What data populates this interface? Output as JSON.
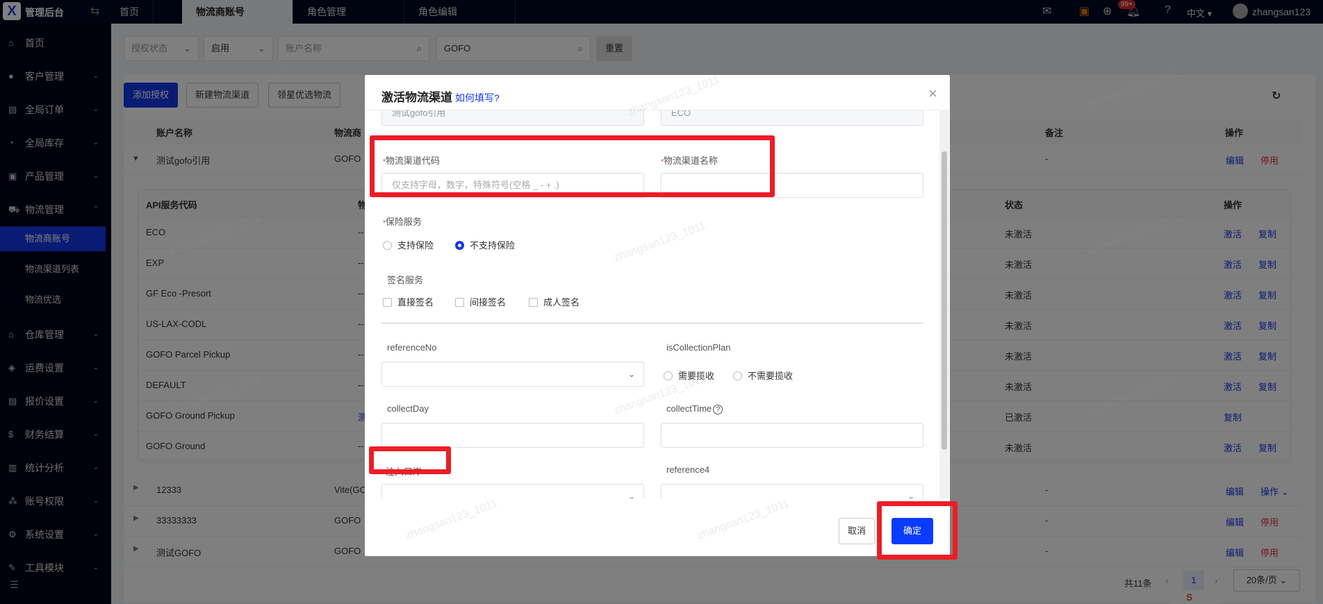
{
  "app": {
    "title": "管理后台",
    "logo": "X"
  },
  "tabs": [
    {
      "label": "首页"
    },
    {
      "label": "物流商账号",
      "active": true
    },
    {
      "label": "角色管理"
    },
    {
      "label": "角色编辑"
    }
  ],
  "header": {
    "notif_badge": "99+",
    "lang": "中文",
    "username": "zhangsan123"
  },
  "sidebar": {
    "items": [
      {
        "label": "首页",
        "icon": "home-icon",
        "glyph": "⌂"
      },
      {
        "label": "客户管理",
        "icon": "user-icon",
        "glyph": "●",
        "arrow": "⌄"
      },
      {
        "label": "全局订单",
        "icon": "order-icon",
        "glyph": "▤",
        "arrow": "⌄"
      },
      {
        "label": "全局库存",
        "icon": "inventory-icon",
        "glyph": "◔",
        "arrow": "⌄"
      },
      {
        "label": "产品管理",
        "icon": "product-icon",
        "glyph": "▣",
        "arrow": "⌄"
      },
      {
        "label": "物流管理",
        "icon": "truck-icon",
        "glyph": "⛟",
        "arrow": "⌃"
      }
    ],
    "sub_items": [
      {
        "label": "物流商账号",
        "active": true
      },
      {
        "label": "物流渠道列表"
      },
      {
        "label": "物流优选"
      }
    ],
    "items2": [
      {
        "label": "仓库管理",
        "icon": "warehouse-icon",
        "glyph": "⌂",
        "arrow": "⌄"
      },
      {
        "label": "运费设置",
        "icon": "freight-icon",
        "glyph": "◈",
        "arrow": "⌄"
      },
      {
        "label": "报价设置",
        "icon": "quote-icon",
        "glyph": "▤",
        "arrow": "⌄"
      },
      {
        "label": "财务结算",
        "icon": "finance-icon",
        "glyph": "$",
        "arrow": "⌄"
      },
      {
        "label": "统计分析",
        "icon": "stats-icon",
        "glyph": "▥",
        "arrow": "⌄"
      },
      {
        "label": "账号权限",
        "icon": "permission-icon",
        "glyph": "⁂",
        "arrow": "⌄"
      },
      {
        "label": "系统设置",
        "icon": "settings-icon",
        "glyph": "⚙",
        "arrow": "⌄"
      },
      {
        "label": "工具模块",
        "icon": "tool-icon",
        "glyph": "✎",
        "arrow": "⌄"
      }
    ],
    "collapse": "☰"
  },
  "filters": {
    "auth_status_placeholder": "授权状态",
    "status_value": "启用",
    "account_placeholder": "账户名称",
    "search_value": "GOFO",
    "reset": "重置"
  },
  "actions": {
    "add_auth": "添加授权",
    "new_channel": "新建物流渠道",
    "lingxing": "领星优选物流"
  },
  "table": {
    "headers": {
      "account": "账户名称",
      "carrier": "物流商",
      "remark": "备注",
      "ops": "操作"
    },
    "expanded_row": {
      "account": "测试gofo引用",
      "carrier": "GOFO",
      "remark": "-",
      "edit": "编辑",
      "disable": "停用"
    },
    "sub_headers": {
      "code": "API服务代码",
      "col2": "物",
      "status": "状态",
      "ops": "操作"
    },
    "sub_rows": [
      {
        "code": "ECO",
        "col2": "--",
        "status": "未激活",
        "activate": "激活",
        "copy": "复制"
      },
      {
        "code": "EXP",
        "col2": "--",
        "status": "未激活",
        "activate": "激活",
        "copy": "复制"
      },
      {
        "code": "GF Eco -Presort",
        "col2": "--",
        "status": "未激活",
        "activate": "激活",
        "copy": "复制"
      },
      {
        "code": "US-LAX-CODL",
        "col2": "--",
        "status": "未激活",
        "activate": "激活",
        "copy": "复制"
      },
      {
        "code": "GOFO Parcel Pickup",
        "col2": "--",
        "status": "未激活",
        "activate": "激活",
        "copy": "复制"
      },
      {
        "code": "DEFAULT",
        "col2": "--",
        "status": "未激活",
        "activate": "激活",
        "copy": "复制"
      },
      {
        "code": "GOFO Ground Pickup",
        "col2": "测",
        "status": "已激活",
        "activate": "",
        "copy": "复制"
      },
      {
        "code": "GOFO Ground",
        "col2": "--",
        "status": "未激活",
        "activate": "激活",
        "copy": "复制"
      }
    ],
    "rows": [
      {
        "account": "12333",
        "carrier": "Vite(GC",
        "remark": "-",
        "edit": "编辑",
        "op2": "操作 ⌄",
        "op2type": "link"
      },
      {
        "account": "33333333",
        "carrier": "GOFO",
        "remark": "-",
        "edit": "编辑",
        "op2": "停用",
        "op2type": "danger"
      },
      {
        "account": "测试GOFO",
        "carrier": "GOFO",
        "remark": "-",
        "edit": "编辑",
        "op2": "停用",
        "op2type": "danger"
      }
    ],
    "pagination": {
      "total": "共11条",
      "page": "1",
      "page_size": "20条/页"
    }
  },
  "dialog": {
    "title": "激活物流渠道",
    "help": "如何填写?",
    "close": "×",
    "top_values": {
      "left": "测试gofo引用",
      "right": "ECO"
    },
    "code_label": "物流渠道代码",
    "code_placeholder": "仅支持字母，数字，特殊符号(空格 _ - + .)",
    "name_label": "物流渠道名称",
    "insurance_label": "保险服务",
    "insurance_options": [
      "支持保险",
      "不支持保险"
    ],
    "insurance_selected": 1,
    "signature_label": "签名服务",
    "signature_options": [
      "直接签名",
      "间接签名",
      "成人签名"
    ],
    "reference_no_label": "referenceNo",
    "collection_label": "isCollectionPlan",
    "collection_options": [
      "需要揽收",
      "不需要揽收"
    ],
    "collect_day_label": "collectDay",
    "collect_time_label": "collectTime",
    "port_label": "注入口岸",
    "reference4_label": "reference4",
    "cancel": "取消",
    "confirm": "确定"
  },
  "watermark": "zhangsan123_1011",
  "colors": {
    "primary": "#1537e8",
    "danger": "#e0313b",
    "annotation": "#ee1c25",
    "topbar": "#010620"
  }
}
